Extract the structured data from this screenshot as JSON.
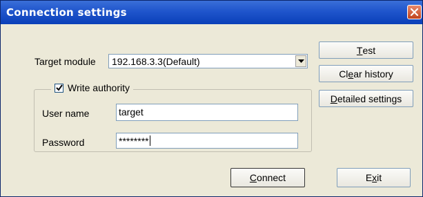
{
  "window": {
    "title": "Connection settings"
  },
  "target_module": {
    "label": "Target module",
    "selected_value": "192.168.3.3(Default)"
  },
  "write_authority": {
    "label": "Write authority",
    "checked": true
  },
  "user_name": {
    "label": "User name",
    "value": "target"
  },
  "password": {
    "label": "Password",
    "masked_value": "********"
  },
  "buttons": {
    "test": {
      "mnemonic": "T",
      "rest": "est"
    },
    "clear_history": {
      "pre": "Cl",
      "mnemonic": "e",
      "rest": "ar history"
    },
    "detailed_settings": {
      "mnemonic": "D",
      "rest": "etailed settings"
    },
    "connect": {
      "mnemonic": "C",
      "rest": "onnect"
    },
    "exit": {
      "pre": "E",
      "mnemonic": "x",
      "rest": "it"
    }
  },
  "icons": {
    "close": "close-icon",
    "dropdown": "chevron-down-icon",
    "check": "checkmark-icon"
  },
  "colors": {
    "titlebar": "#1f55cc",
    "close_button": "#c0431e",
    "dialog_face": "#ece9d8"
  }
}
